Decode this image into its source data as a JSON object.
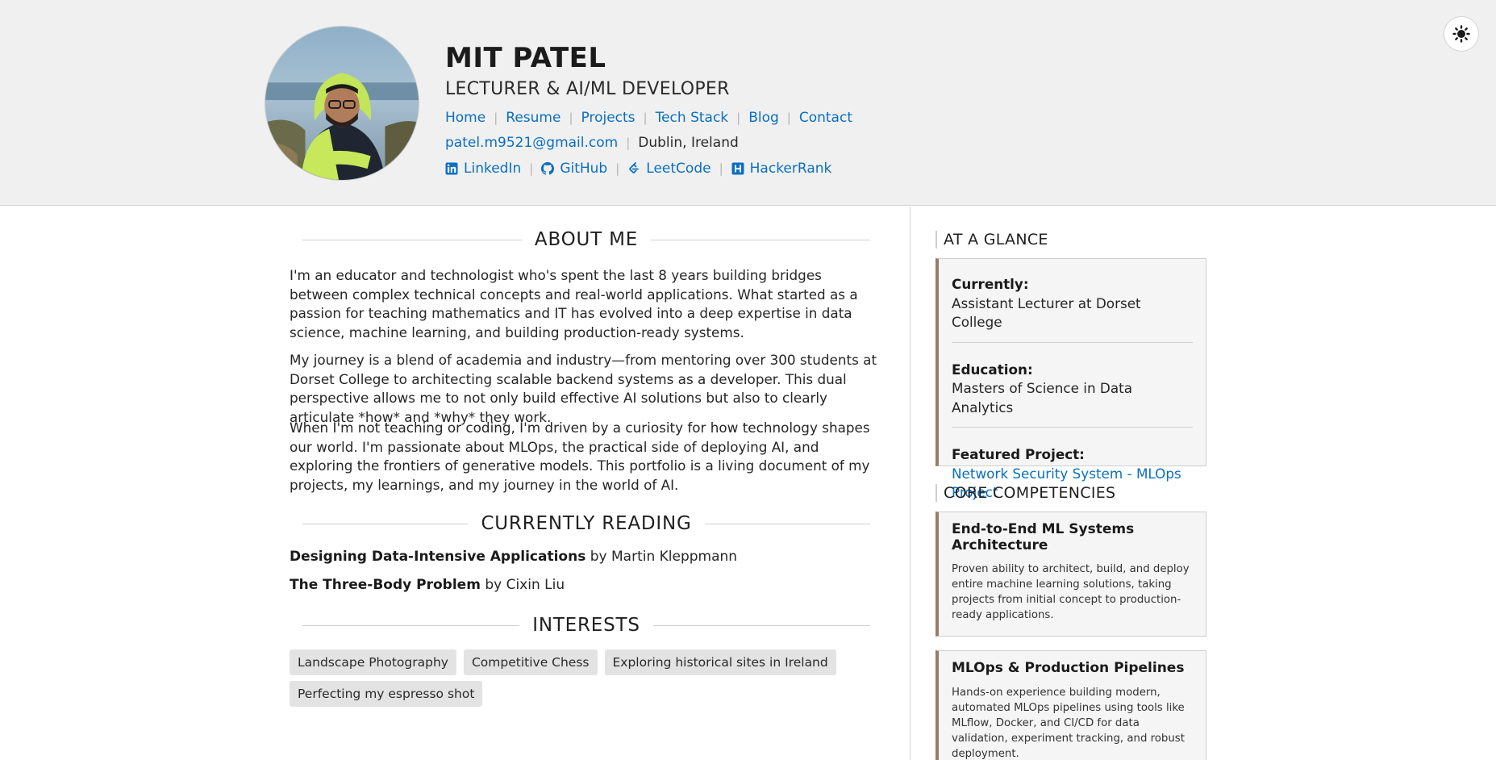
{
  "header": {
    "name": "MIT PATEL",
    "role": "LECTURER & AI/ML DEVELOPER",
    "nav": [
      {
        "label": "Home"
      },
      {
        "label": "Resume"
      },
      {
        "label": "Projects"
      },
      {
        "label": "Tech Stack"
      },
      {
        "label": "Blog"
      },
      {
        "label": "Contact"
      }
    ],
    "email": "patel.m9521@gmail.com",
    "location": "Dublin, Ireland",
    "social": [
      {
        "label": "LinkedIn",
        "icon": "linkedin-icon"
      },
      {
        "label": "GitHub",
        "icon": "github-icon"
      },
      {
        "label": "LeetCode",
        "icon": "leetcode-icon"
      },
      {
        "label": "HackerRank",
        "icon": "hackerrank-icon"
      }
    ],
    "theme_toggle_icon": "sun-icon"
  },
  "about": {
    "title": "ABOUT ME",
    "paragraphs": [
      "I'm an educator and technologist who's spent the last 8 years building bridges between complex technical concepts and real-world applications. What started as a passion for teaching mathematics and IT has evolved into a deep expertise in data science, machine learning, and building production-ready systems.",
      "My journey is a blend of academia and industry—from mentoring over 300 students at Dorset College to architecting scalable backend systems as a developer. This dual perspective allows me to not only build effective AI solutions but also to clearly articulate *how* and *why* they work.",
      "When I'm not teaching or coding, I'm driven by a curiosity for how technology shapes our world. I'm passionate about MLOps, the practical side of deploying AI, and exploring the frontiers of generative models. This portfolio is a living document of my projects, my learnings, and my journey in the world of AI."
    ]
  },
  "reading": {
    "title": "CURRENTLY READING",
    "books": [
      {
        "title": "Designing Data-Intensive Applications",
        "author": "by Martin Kleppmann"
      },
      {
        "title": "The Three-Body Problem",
        "author": "by Cixin Liu"
      }
    ]
  },
  "interests": {
    "title": "INTERESTS",
    "items": [
      "Landscape Photography",
      "Competitive Chess",
      "Exploring historical sites in Ireland",
      "Perfecting my espresso shot"
    ]
  },
  "glance": {
    "title": "AT A GLANCE",
    "currently_label": "Currently:",
    "currently_value": "Assistant Lecturer at Dorset College",
    "education_label": "Education:",
    "education_value": "Masters of Science in Data Analytics",
    "featured_label": "Featured Project:",
    "featured_value": "Network Security System - MLOps Project"
  },
  "competencies": {
    "title": "CORE COMPETENCIES",
    "items": [
      {
        "title": "End-to-End ML Systems Architecture",
        "text": "Proven ability to architect, build, and deploy entire machine learning solutions, taking projects from initial concept to production-ready applications."
      },
      {
        "title": "MLOps & Production Pipelines",
        "text": "Hands-on experience building modern, automated MLOps pipelines using tools like MLflow, Docker, and CI/CD for data validation, experiment tracking, and robust deployment."
      }
    ]
  },
  "colors": {
    "link": "#0a6fc2",
    "header_bg": "#f0f0f0",
    "card_accent": "#9b7a68",
    "tag_bg": "#e3e3e3"
  }
}
